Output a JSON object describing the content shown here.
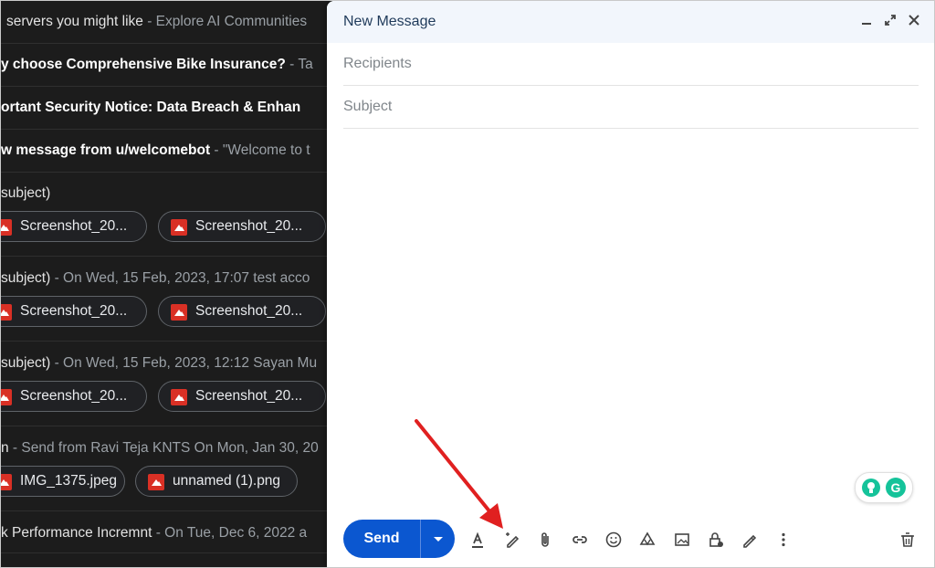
{
  "inbox": {
    "rows": [
      {
        "subject": "servers you might like",
        "snippet": " - Explore AI Communities"
      },
      {
        "subject": "y choose Comprehensive Bike Insurance?",
        "snippet": " - Ta"
      },
      {
        "subject": "ortant Security Notice: Data Breach & Enhan",
        "snippet": ""
      },
      {
        "subject": "w message from u/welcomebot",
        "snippet": " - \"Welcome to t"
      },
      {
        "subject": "subject)",
        "snippet": ""
      },
      {
        "subject": "subject)",
        "snippet": " - On Wed, 15 Feb, 2023, 17:07 test acco"
      },
      {
        "subject": "subject)",
        "snippet": " - On Wed, 15 Feb, 2023, 12:12 Sayan Mu"
      },
      {
        "subject": "n",
        "snippet": " - Send from Ravi Teja KNTS On Mon, Jan 30, 20"
      },
      {
        "subject": "k Performance Incremnt",
        "snippet": " - On Tue, Dec 6, 2022 a"
      }
    ],
    "attachments_row1": [
      "Screenshot_20...",
      "Screenshot_20..."
    ],
    "attachments_row2": [
      "Screenshot_20...",
      "Screenshot_20..."
    ],
    "attachments_row3": [
      "Screenshot_20...",
      "Screenshot_20..."
    ],
    "attachments_row4": [
      "IMG_1375.jpeg",
      "unnamed (1).png"
    ]
  },
  "compose": {
    "title": "New Message",
    "recipients_placeholder": "Recipients",
    "subject_placeholder": "Subject",
    "send_label": "Send",
    "header_icons": [
      "minimize-icon",
      "expand-icon",
      "close-icon"
    ],
    "toolbar_icons": [
      "formatting-icon",
      "help-me-write-icon",
      "attach-icon",
      "link-icon",
      "emoji-icon",
      "drive-icon",
      "photo-icon",
      "confidential-icon",
      "signature-icon",
      "more-options-icon",
      "discard-icon"
    ]
  },
  "colors": {
    "send_button": "#0b57d0",
    "annotation_arrow": "#e02020",
    "grammarly": "#15c39a"
  }
}
